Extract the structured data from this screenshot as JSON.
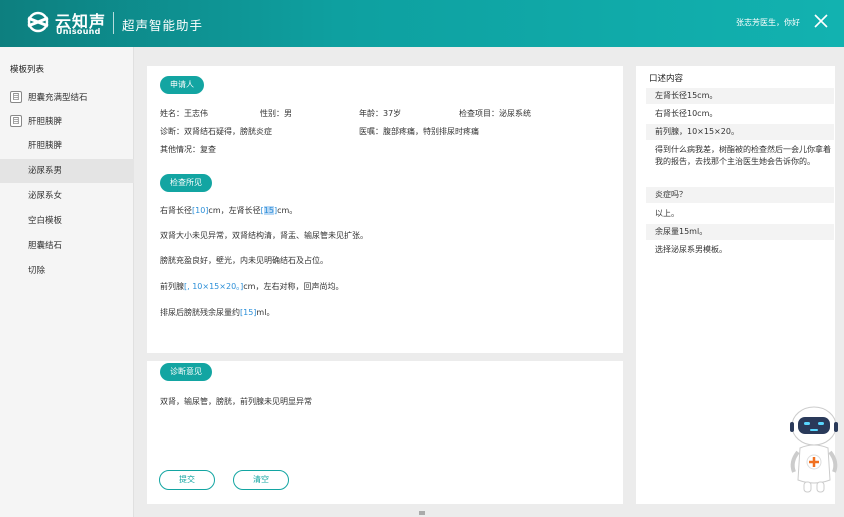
{
  "header": {
    "logo_cn": "云知声",
    "logo_en": "Unisound",
    "app_title": "超声智能助手",
    "greeting": "张志芳医生，你好"
  },
  "sidebar": {
    "title": "模板列表",
    "folders": [
      {
        "label": "胆囊充满型结石"
      },
      {
        "label": "肝胆胰脾"
      }
    ],
    "folder_icon_glyph": "目",
    "items": [
      {
        "label": "肝胆胰脾"
      },
      {
        "label": "泌尿系男"
      },
      {
        "label": "泌尿系女"
      },
      {
        "label": "空白模板"
      },
      {
        "label": "胆囊结石"
      },
      {
        "label": "切除"
      }
    ],
    "active_index": 1
  },
  "applicant": {
    "section_label": "申请人",
    "name": "姓名：王志伟",
    "gender": "性别：男",
    "age": "年龄：37岁",
    "exam_item": "检查项目：泌尿系统",
    "diagnosis": "诊断：双肾结石疑得，膀胱炎症",
    "doctor_note": "医嘱：腹部疼痛，特别排尿时疼痛",
    "other": "其他情况：复查"
  },
  "findings": {
    "section_label": "检查所见",
    "l1_pre": "右肾长径",
    "l1_v1": "[10]",
    "l1_mid": "cm，左肾长径",
    "l1_v2_open": "[",
    "l1_v2_val": "15",
    "l1_v2_close": "]",
    "l1_post": "cm。",
    "l2": "双肾大小未见异常，双肾结构清，肾盂、输尿管未见扩张。",
    "l3": "膀胱充盈良好，壁光，内未见明确结石及占位。",
    "l4_pre": "前列腺",
    "l4_v": "[, 10×15×20。]",
    "l4_post": "cm，左右对称，回声尚均。",
    "l5_pre": "排尿后膀胱残余尿量约",
    "l5_v": "[15]",
    "l5_post": "ml。"
  },
  "opinion": {
    "section_label": "诊断意见",
    "text": "双肾，输尿管，膀胱，前列腺未见明显异常"
  },
  "buttons": {
    "submit": "提交",
    "clear": "清空"
  },
  "dictation": {
    "title": "口述内容",
    "lines": [
      "左肾长径15cm。",
      "右肾长径10cm。",
      "前列腺，10×15×20。",
      "得到什么病我差，树酯被的检查然后一会儿你拿着我的报告，去找那个主治医生她会告诉你的。",
      "炎症吗？",
      "以上。",
      "余尿量15ml。",
      "选择泌尿系男模板。"
    ]
  },
  "colors": {
    "accent": "#13a5a2",
    "header_start": "#0d7f7f",
    "header_end": "#12b2b0",
    "field_value": "#2c8fd8"
  },
  "icons": {
    "close": "close-icon",
    "logo": "unisound-logo-icon",
    "robot": "robot-assistant-icon"
  }
}
